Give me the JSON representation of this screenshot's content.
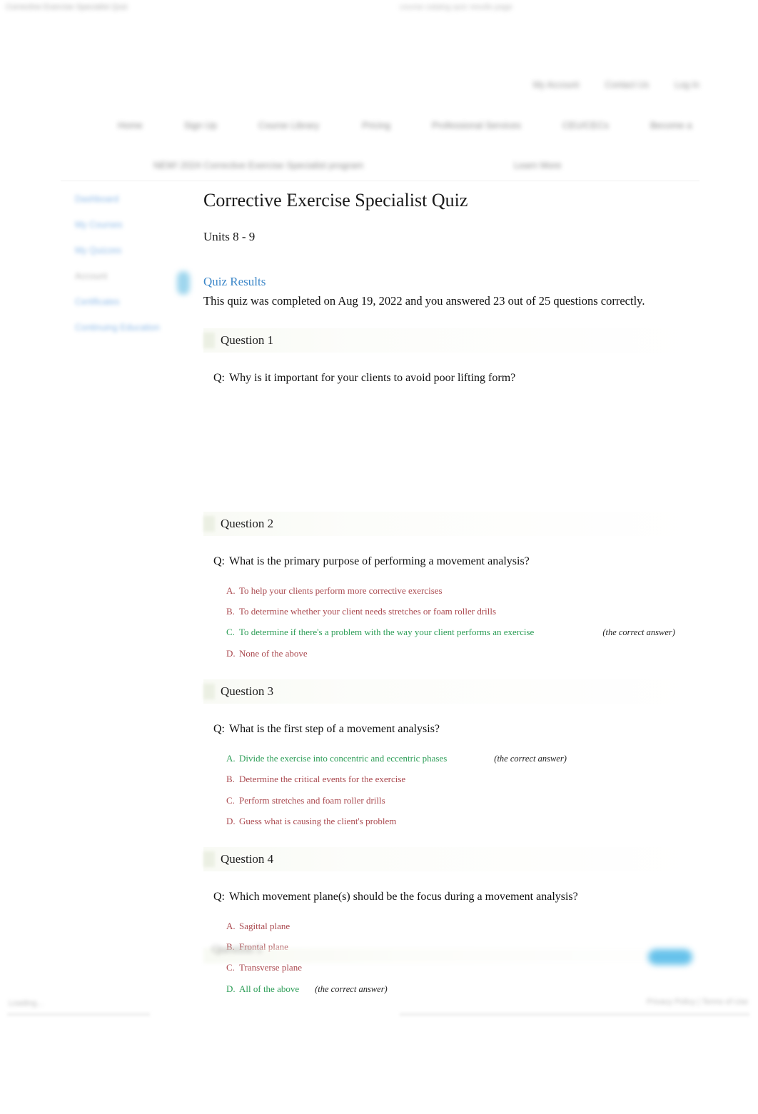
{
  "browser": {
    "tab_title": "Corrective Exercise Specialist Quiz",
    "url": "course catalog quiz results page"
  },
  "header": {
    "utility_nav": [
      "My Account",
      "Contact Us",
      "Log In"
    ],
    "main_nav": [
      "Home",
      "Sign Up",
      "Course Library",
      "Pricing",
      "Professional Services",
      "CEU/CECs",
      "Become a"
    ],
    "sub_nav": {
      "promo": "NEW! 2024 Corrective Exercise Specialist program",
      "link": "Learn More"
    }
  },
  "sidebar": {
    "items": [
      {
        "label": "Dashboard",
        "state": "link"
      },
      {
        "label": "My Courses",
        "state": "link"
      },
      {
        "label": "My Quizzes",
        "state": "link"
      },
      {
        "label": "Account",
        "state": "inactive"
      },
      {
        "label": "Certificates",
        "state": "link"
      },
      {
        "label": "Continuing Education",
        "state": "link"
      }
    ],
    "badge": "notification-badge"
  },
  "main": {
    "title": "Corrective Exercise Specialist Quiz",
    "units": "Units 8 - 9",
    "results_heading": "Quiz Results",
    "results_text": "This quiz was completed on Aug 19, 2022 and you answered 23 out of 25 questions correctly.",
    "correct_note": "(the correct answer)",
    "q_prefix": "Q:",
    "questions": [
      {
        "label": "Question 1",
        "text": "Why is it important for your clients to avoid poor lifting form?",
        "answers": []
      },
      {
        "label": "Question 2",
        "text": "What is the primary purpose of performing a movement analysis?",
        "answers": [
          {
            "letter": "A.",
            "text": "To help your clients perform more corrective exercises",
            "correct": false
          },
          {
            "letter": "B.",
            "text": "To determine whether your client needs stretches or foam roller drills",
            "correct": false
          },
          {
            "letter": "C.",
            "text": "To determine if there's a problem with the way your client performs an exercise",
            "correct": true
          },
          {
            "letter": "D.",
            "text": "None of the above",
            "correct": false
          }
        ]
      },
      {
        "label": "Question 3",
        "text": "What is the first step of a movement analysis?",
        "answers": [
          {
            "letter": "A.",
            "text": "Divide the exercise into concentric and eccentric phases",
            "correct": true
          },
          {
            "letter": "B.",
            "text": "Determine the critical events for the exercise",
            "correct": false
          },
          {
            "letter": "C.",
            "text": "Perform stretches and foam roller drills",
            "correct": false
          },
          {
            "letter": "D.",
            "text": "Guess what is causing the client's problem",
            "correct": false
          }
        ]
      },
      {
        "label": "Question 4",
        "text": "Which movement plane(s) should be the focus during a movement analysis?",
        "answers": [
          {
            "letter": "A.",
            "text": "Sagittal plane",
            "correct": false
          },
          {
            "letter": "B.",
            "text": "Frontal plane",
            "correct": false
          },
          {
            "letter": "C.",
            "text": "Transverse plane",
            "correct": false
          },
          {
            "letter": "D.",
            "text": "All of the above",
            "correct": true
          }
        ]
      }
    ],
    "next_question_label": "Question 5"
  },
  "footer": {
    "left": "Loading...",
    "right": "Privacy Policy | Terms of Use"
  },
  "colors": {
    "link_blue": "#3b86c8",
    "correct_green": "#2e9e58",
    "incorrect_red": "#ab4a50",
    "badge_blue": "#7ec8e8",
    "question_band": "#f3f6ec"
  }
}
